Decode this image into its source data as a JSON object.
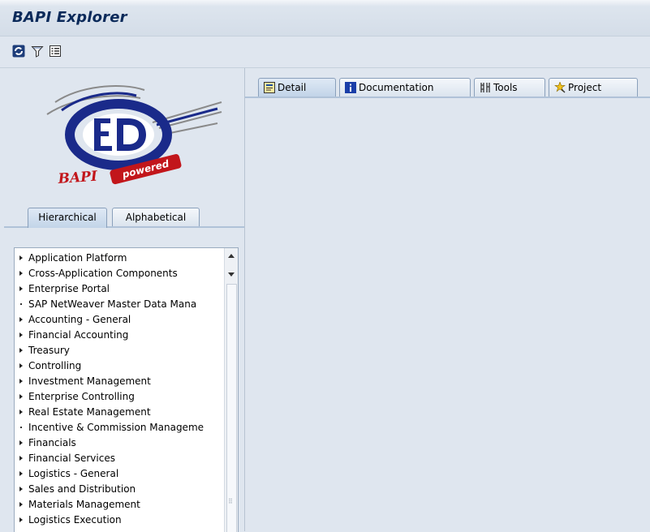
{
  "window": {
    "title": "BAPI Explorer"
  },
  "toolbar": {
    "buttons": [
      {
        "icon": "refresh-icon",
        "tooltip": ""
      },
      {
        "icon": "filter-icon",
        "tooltip": ""
      },
      {
        "icon": "list-icon",
        "tooltip": ""
      }
    ]
  },
  "logo": {
    "text": "BAPIpowered"
  },
  "left_tabs": [
    {
      "label": "Hierarchical",
      "active": true
    },
    {
      "label": "Alphabetical",
      "active": false
    }
  ],
  "tree": {
    "items": [
      {
        "label": "Application Platform",
        "expandable": true
      },
      {
        "label": "Cross-Application Components",
        "expandable": true
      },
      {
        "label": "Enterprise Portal",
        "expandable": true
      },
      {
        "label": "SAP NetWeaver Master Data Mana",
        "expandable": false
      },
      {
        "label": "Accounting - General",
        "expandable": true
      },
      {
        "label": "Financial Accounting",
        "expandable": true
      },
      {
        "label": "Treasury",
        "expandable": true
      },
      {
        "label": "Controlling",
        "expandable": true
      },
      {
        "label": "Investment Management",
        "expandable": true
      },
      {
        "label": "Enterprise Controlling",
        "expandable": true
      },
      {
        "label": "Real Estate Management",
        "expandable": true
      },
      {
        "label": "Incentive & Commission Manageme",
        "expandable": false
      },
      {
        "label": "Financials",
        "expandable": true
      },
      {
        "label": "Financial Services",
        "expandable": true
      },
      {
        "label": "Logistics - General",
        "expandable": true
      },
      {
        "label": "Sales and Distribution",
        "expandable": true
      },
      {
        "label": "Materials Management",
        "expandable": true
      },
      {
        "label": "Logistics Execution",
        "expandable": true
      }
    ]
  },
  "right_tabs": [
    {
      "label": "Detail",
      "icon": "detail-icon",
      "active": true
    },
    {
      "label": "Documentation",
      "icon": "info-icon",
      "active": false
    },
    {
      "label": "Tools",
      "icon": "tools-icon",
      "active": false
    },
    {
      "label": "Project",
      "icon": "project-icon",
      "active": false
    }
  ],
  "colors": {
    "accent": "#0b2a5a",
    "background": "#dfe6ef",
    "tab_active": "#c2d4e8"
  }
}
